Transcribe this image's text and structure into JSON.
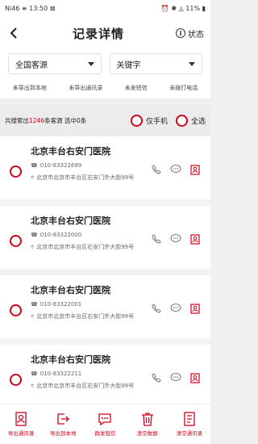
{
  "statusbar": {
    "left": "Ni46 ≡ 13:50 ⊠",
    "right": "⏰ ✱ ◬ 11% ▮"
  },
  "titlebar": {
    "title": "记录详情",
    "state_label": "状态"
  },
  "filters": [
    {
      "label": "全国客源"
    },
    {
      "label": "关键字"
    }
  ],
  "tabs": [
    {
      "label": "未导出到本地"
    },
    {
      "label": "未导出通讯录"
    },
    {
      "label": "未发短信"
    },
    {
      "label": "未拨打电话"
    }
  ],
  "summary": {
    "prefix": "共搜索出",
    "count": "1246",
    "suffix": "条客源  选中0条",
    "opt1": "仅手机",
    "opt2": "全选"
  },
  "items": [
    {
      "name": "北京丰台右安门医院",
      "phone": "010-83322699",
      "addr": "北京市北京市丰台区右安门外大街99号"
    },
    {
      "name": "北京丰台右安门医院",
      "phone": "010-83322000",
      "addr": "北京市北京市丰台区右安门外大街99号"
    },
    {
      "name": "北京丰台右安门医院",
      "phone": "010-83322001",
      "addr": "北京市北京市丰台区右安门外大街99号"
    },
    {
      "name": "北京丰台右安门医院",
      "phone": "010-83322211",
      "addr": "北京市北京市丰台区右安门外大街99号"
    }
  ],
  "bottom": [
    {
      "label": "导出通讯录",
      "icon": "contact-icon"
    },
    {
      "label": "导出到本地",
      "icon": "export-icon"
    },
    {
      "label": "群发短信",
      "icon": "sms-icon"
    },
    {
      "label": "清空数据",
      "icon": "trash-icon"
    },
    {
      "label": "清空通讯录",
      "icon": "clear-contacts-icon"
    }
  ],
  "colors": {
    "accent": "#d0021b"
  }
}
